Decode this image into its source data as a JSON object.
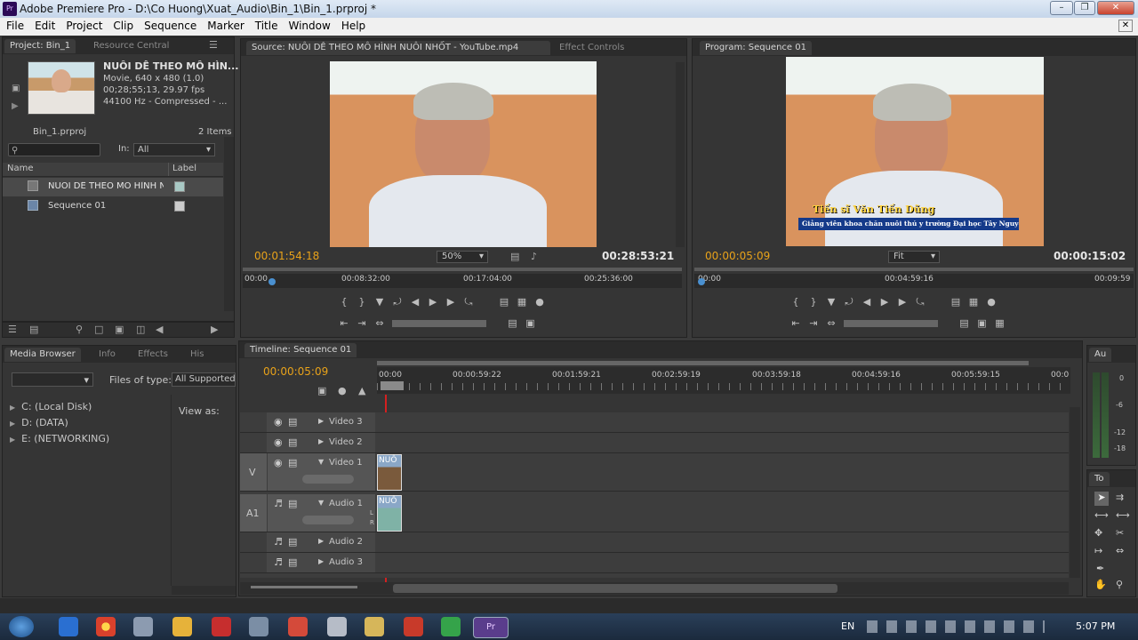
{
  "window": {
    "title": "Adobe Premiere Pro - D:\\Co Huong\\Xuat_Audio\\Bin_1\\Bin_1.prproj *",
    "app_badge": "Pr"
  },
  "menu": [
    "File",
    "Edit",
    "Project",
    "Clip",
    "Sequence",
    "Marker",
    "Title",
    "Window",
    "Help"
  ],
  "project_panel": {
    "tabs": [
      "Project: Bin_1",
      "Resource Central"
    ],
    "clip_name": "NUÔI DÊ THEO MÔ HÌN...",
    "clip_line1": "Movie, 640 x 480 (1.0)",
    "clip_line2": "00;28;55;13, 29.97 fps",
    "clip_line3": "44100 Hz - Compressed - ...",
    "bin_name": "Bin_1.prproj",
    "item_count": "2 Items",
    "in_label": "In:",
    "in_value": "All",
    "col_name": "Name",
    "col_label": "Label",
    "items": [
      {
        "name": "NUÔI DÊ THEO MÔ HÌNH N"
      },
      {
        "name": "Sequence 01"
      }
    ]
  },
  "source_monitor": {
    "tab": "Source: NUÔI DÊ THEO MÔ HÌNH NUÔI NHỐT - YouTube.mp4",
    "tab2": "Effect Controls",
    "timecode": "00:01:54:18",
    "zoom": "50%",
    "duration": "00:28:53:21",
    "ruler": [
      "00:00",
      "00:08:32:00",
      "00:17:04:00",
      "00:25:36:00"
    ]
  },
  "program_monitor": {
    "tab": "Program: Sequence 01",
    "timecode": "00:00:05:09",
    "zoom": "Fit",
    "duration": "00:00:15:02",
    "ruler": [
      "00:00",
      "00:04:59:16",
      "00:09:59"
    ],
    "caption_name": "Tiến sĩ Văn Tiến Dũng",
    "caption_role": "Giảng viên khoa chăn nuôi thú y trường Đại học Tây Nguyên"
  },
  "media_browser": {
    "tabs": [
      "Media Browser",
      "Info",
      "Effects",
      "His"
    ],
    "files_of_type_label": "Files of type:",
    "files_of_type_value": "All Supported",
    "view_as": "View as:",
    "drives": [
      "C: (Local Disk)",
      "D: (DATA)",
      "E: (NETWORKING)"
    ]
  },
  "timeline": {
    "tab": "Timeline: Sequence 01",
    "timecode": "00:00:05:09",
    "ruler": [
      "00:00",
      "00:00:59:22",
      "00:01:59:21",
      "00:02:59:19",
      "00:03:59:18",
      "00:04:59:16",
      "00:05:59:15",
      "00:0"
    ],
    "video_tracks": [
      "Video 3",
      "Video 2",
      "Video 1"
    ],
    "audio_tracks": [
      "Audio 1",
      "Audio 2",
      "Audio 3"
    ],
    "v_label": "V",
    "a_label": "A1",
    "clip_label": "NUÔ",
    "audio_lr": [
      "L",
      "R"
    ]
  },
  "audio_meter": {
    "tab": "Au",
    "scale": [
      "0",
      "-6",
      "-12",
      "-18"
    ]
  },
  "tools": {
    "tab": "To"
  },
  "taskbar": {
    "lang": "EN",
    "time": "5:07 PM"
  },
  "colors": {
    "accent_timecode": "#e8a21a",
    "playhead": "#d42020",
    "label_swatch": "#a8c8c4"
  }
}
